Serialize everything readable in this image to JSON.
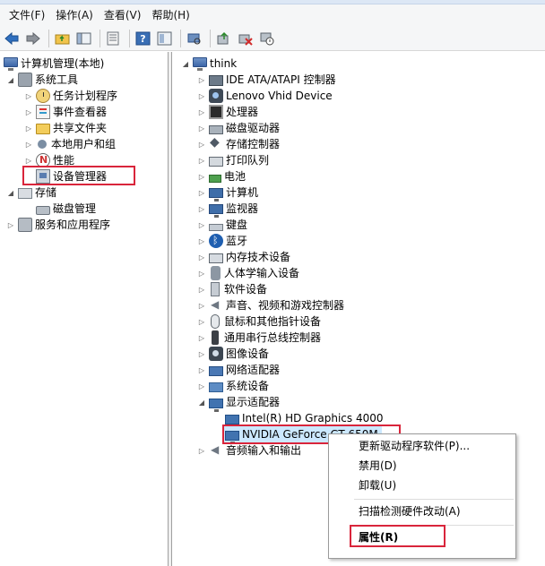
{
  "menubar": {
    "items": [
      "文件(F)",
      "操作(A)",
      "查看(V)",
      "帮助(H)"
    ]
  },
  "toolbar": {
    "buttons": [
      "back-icon",
      "forward-icon",
      "up-folder-icon",
      "show-hide-tree-icon",
      "export-list-icon",
      "help-icon",
      "properties-icon",
      "scan-hardware-icon",
      "update-driver-icon",
      "uninstall-icon",
      "disable-icon"
    ]
  },
  "left_tree": {
    "root": "计算机管理(本地)",
    "system_tools": "系统工具",
    "task_scheduler": "任务计划程序",
    "event_viewer": "事件查看器",
    "shared_folders": "共享文件夹",
    "local_users": "本地用户和组",
    "performance": "性能",
    "device_manager": "设备管理器",
    "storage": "存储",
    "disk_management": "磁盘管理",
    "services": "服务和应用程序"
  },
  "device_tree": {
    "root": "think",
    "categories": [
      "IDE ATA/ATAPI 控制器",
      "Lenovo Vhid Device",
      "处理器",
      "磁盘驱动器",
      "存储控制器",
      "打印队列",
      "电池",
      "计算机",
      "监视器",
      "键盘",
      "蓝牙",
      "内存技术设备",
      "人体学输入设备",
      "软件设备",
      "声音、视频和游戏控制器",
      "鼠标和其他指针设备",
      "通用串行总线控制器",
      "图像设备",
      "网络适配器",
      "系统设备",
      "显示适配器"
    ],
    "display_adapters": [
      "Intel(R) HD Graphics 4000",
      "NVIDIA GeForce GT 650M"
    ],
    "audio_io": "音频输入和输出"
  },
  "context_menu": {
    "update_driver": "更新驱动程序软件(P)...",
    "disable": "禁用(D)",
    "uninstall": "卸载(U)",
    "scan": "扫描检测硬件改动(A)",
    "properties": "属性(R)"
  },
  "colors": {
    "highlight_box": "#d9253b",
    "selected_row": "#cce8ff"
  }
}
